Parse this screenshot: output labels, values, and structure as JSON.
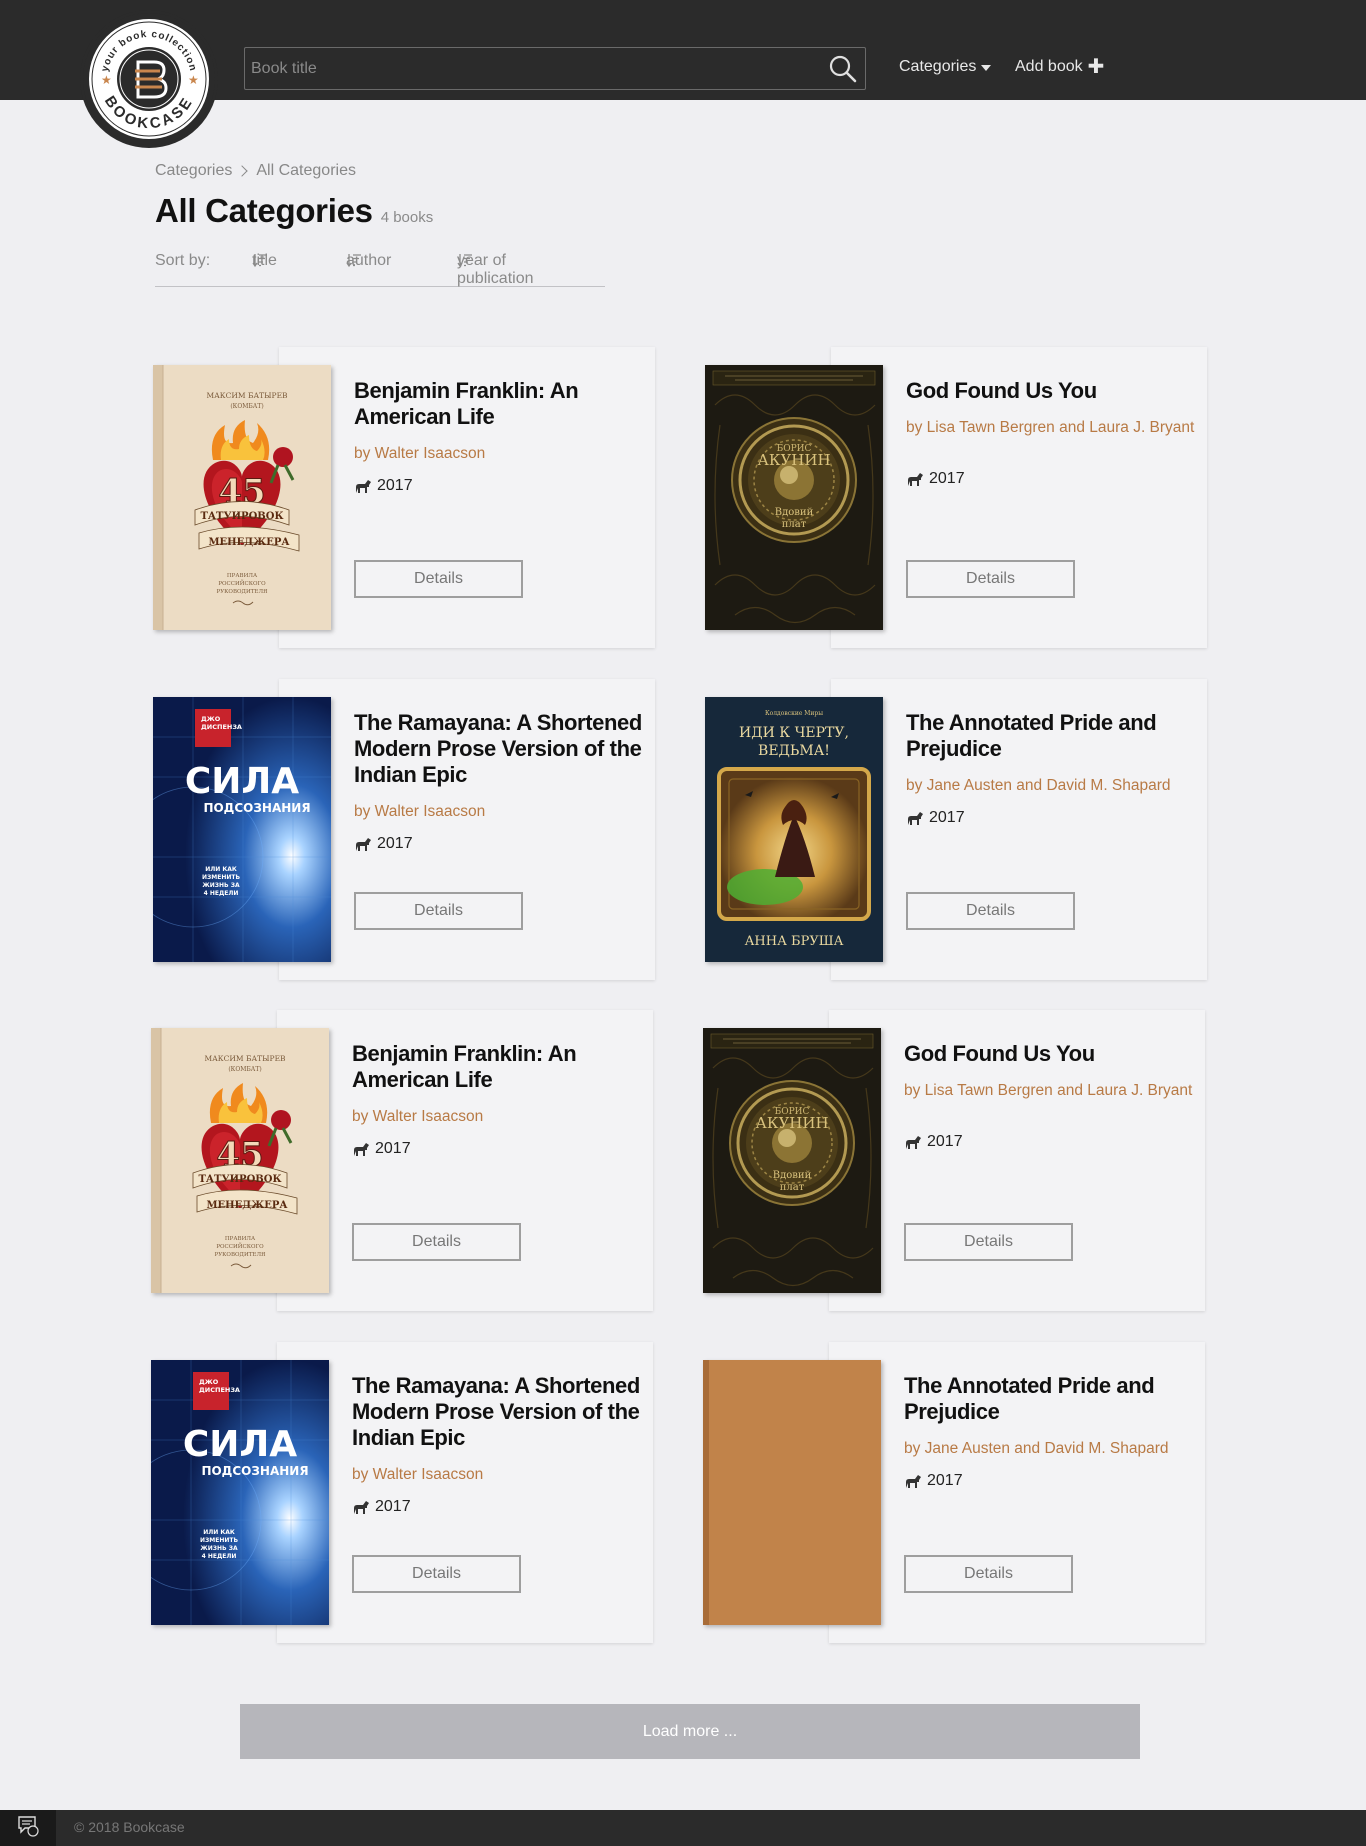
{
  "header": {
    "logo_arc_text": "your book collection",
    "logo_brand": "BOOKCASE",
    "search_placeholder": "Book title",
    "nav_categories": "Categories",
    "nav_add_book": "Add book"
  },
  "breadcrumb": {
    "items": [
      "Categories",
      "All Categories"
    ]
  },
  "page": {
    "title": "All Categories",
    "count": "4 books"
  },
  "sort": {
    "label": "Sort by:",
    "options": [
      "title",
      "author",
      "year of publication"
    ]
  },
  "books": [
    {
      "title": "Benjamin Franklin: An American Life",
      "author": "by Walter Isaacson",
      "year": "2017",
      "cover": "managers",
      "details": "Details"
    },
    {
      "title": "God Found Us You",
      "author": "by Lisa Tawn Bergren and Laura J. Bryant",
      "year": "2017",
      "cover": "akunin",
      "details": "Details"
    },
    {
      "title": "The Ramayana: A Shortened Modern Prose Version of the Indian Epic",
      "author": "by Walter Isaacson",
      "year": "2017",
      "cover": "sila",
      "details": "Details"
    },
    {
      "title": "The Annotated Pride and Prejudice",
      "author": "by Jane Austen and David M. Shapard",
      "year": "2017",
      "cover": "witch",
      "details": "Details"
    },
    {
      "title": "Benjamin Franklin: An American Life",
      "author": "by Walter Isaacson",
      "year": "2017",
      "cover": "managers",
      "details": "Details"
    },
    {
      "title": "God Found Us You",
      "author": "by Lisa Tawn Bergren and Laura J. Bryant",
      "year": "2017",
      "cover": "akunin",
      "details": "Details"
    },
    {
      "title": "The Ramayana: A Shortened Modern Prose Version of the Indian Epic",
      "author": "by Walter Isaacson",
      "year": "2017",
      "cover": "sila",
      "details": "Details"
    },
    {
      "title": "The Annotated Pride and Prejudice",
      "author": "by Jane Austen and David M. Shapard",
      "year": "2017",
      "cover": "blank",
      "details": "Details"
    }
  ],
  "covers": {
    "managers": {
      "top": "МАКСИМ БАТЫРЕВ",
      "sub": "(КОМБАТ)",
      "num": "45",
      "line1": "ТАТУИРОВОК",
      "line2": "МЕНЕДЖЕРА",
      "small1": "ПРАВИЛА",
      "small2": "РОССИЙСКОГО",
      "small3": "РУКОВОДИТЕЛЯ"
    },
    "akunin": {
      "line1": "БОРИС",
      "line2": "АКУНИН",
      "line3": "Вдовий",
      "line4": "плат"
    },
    "sila": {
      "top1": "ДЖО",
      "top2": "ДИСПЕНЗА",
      "big": "СИЛА",
      "sub": "ПОДСОЗНАНИЯ",
      "small1": "ИЛИ КАК",
      "small2": "ИЗМЕНИТЬ",
      "small3": "ЖИЗНЬ ЗА",
      "small4": "4 НЕДЕЛИ"
    },
    "witch": {
      "top": "Колдовские Миры",
      "line1": "ИДИ К ЧЕРТУ,",
      "line2": "ВЕДЬМА!",
      "author": "АННА БРУША"
    }
  },
  "load_more": "Load more ...",
  "footer": {
    "copyright": "© 2018 Bookcase"
  },
  "colors": {
    "header_bg": "#2b2b2b",
    "page_bg": "#efeff2",
    "accent_author": "#b87a45",
    "blank_cover": "#c1834a"
  }
}
